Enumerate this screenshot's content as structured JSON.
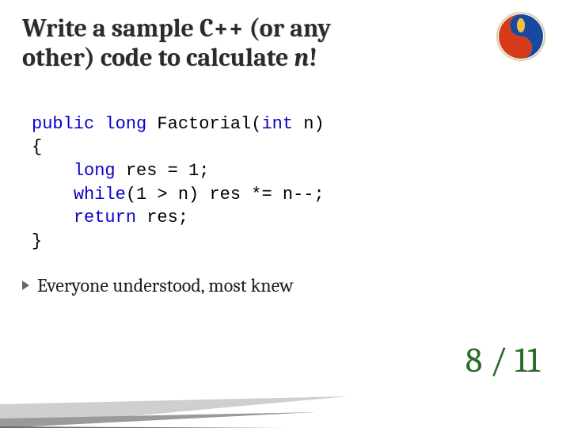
{
  "title": {
    "line1": "Write a sample C++ (or any",
    "line2_a": "other) code to calculate ",
    "line2_b_italic": "n",
    "line2_c": "!"
  },
  "code": {
    "l1_kw1": "public",
    "l1_sp1": " ",
    "l1_kw2": "long",
    "l1_rest": " Factorial(",
    "l1_kw3": "int",
    "l1_rest2": " n)",
    "l2": "{",
    "l3_indent": "    ",
    "l3_kw": "long",
    "l3_rest": " res = 1;",
    "l4_indent": "    ",
    "l4_kw": "while",
    "l4_rest": "(1 > n) res *= n--;",
    "l5_indent": "    ",
    "l5_kw": "return",
    "l5_rest": " res;",
    "l6": "}"
  },
  "bullet": "Everyone understood, most knew",
  "score": "8 / 11"
}
